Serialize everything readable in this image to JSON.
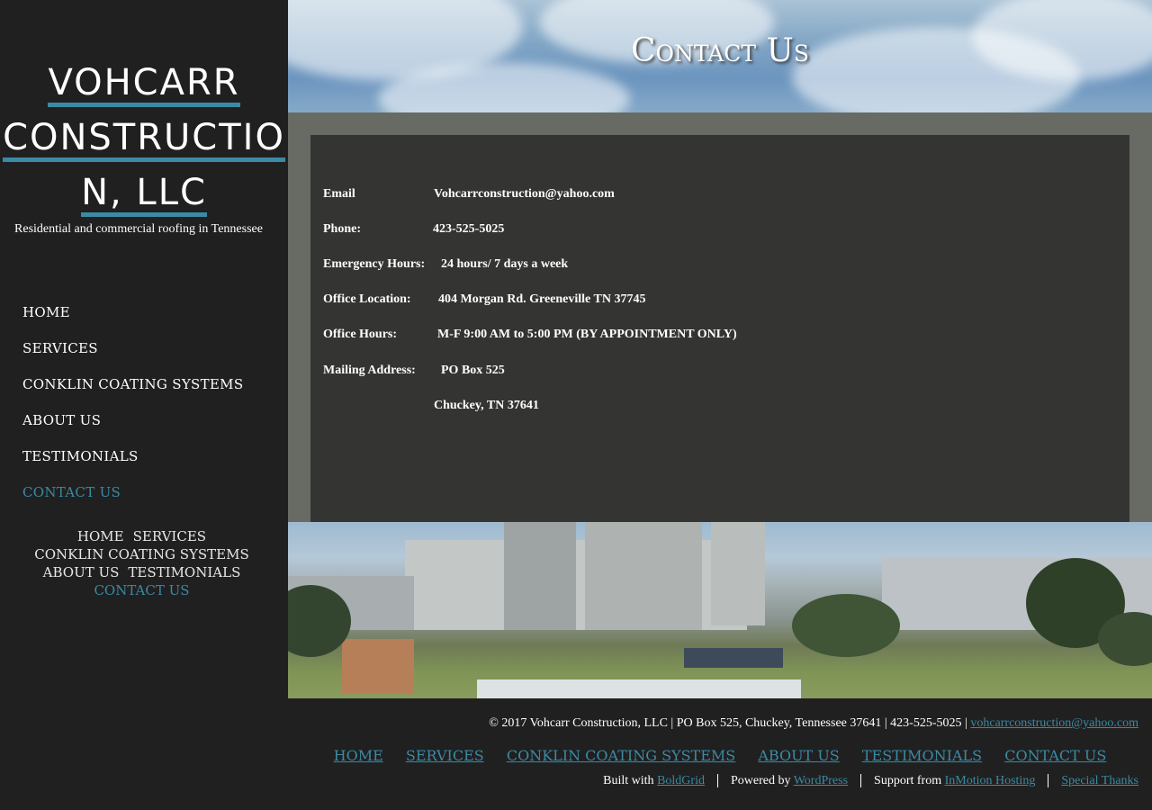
{
  "logo": {
    "line1": "VOHCARR",
    "line2": "CONSTRUCTIO",
    "line3": "N, LLC"
  },
  "tagline": "Residential and commercial roofing in Tennessee",
  "main_nav": [
    {
      "label": "HOME"
    },
    {
      "label": "SERVICES"
    },
    {
      "label": "CONKLIN COATING SYSTEMS"
    },
    {
      "label": "ABOUT US"
    },
    {
      "label": "TESTIMONIALS"
    },
    {
      "label": "CONTACT US"
    }
  ],
  "mini_nav": [
    "HOME",
    "SERVICES",
    "CONKLIN COATING SYSTEMS",
    "ABOUT US",
    "TESTIMONIALS",
    "CONTACT US"
  ],
  "hero_title": "Contact Us",
  "contact": {
    "email_label": "Email",
    "email_value": "Vohcarrconstruction@yahoo.com",
    "phone_label": "Phone:",
    "phone_value": "423-525-5025",
    "emergency_label": "Emergency Hours:",
    "emergency_value": "24 hours/ 7 days a week",
    "office_label": "Office Location:",
    "office_value": "404 Morgan Rd. Greeneville TN 37745",
    "hours_label": "Office Hours:",
    "hours_value": "M-F 9:00 AM to 5:00 PM (BY APPOINTMENT ONLY)",
    "mailing_label": "Mailing Address:",
    "mailing_value1": "PO Box 525",
    "mailing_value2": "Chuckey, TN 37641"
  },
  "footer": {
    "copyright": "© 2017 Vohcarr Construction, LLC | PO Box 525, Chuckey, Tennessee 37641 | 423-525-5025 |",
    "email": "vohcarrconstruction@yahoo.com",
    "nav": [
      "HOME",
      "SERVICES",
      "CONKLIN COATING SYSTEMS",
      "ABOUT US",
      "TESTIMONIALS",
      "CONTACT US"
    ],
    "built_text": "Built with",
    "built_link": "BoldGrid",
    "powered_text": "Powered by",
    "powered_link": "WordPress",
    "support_text": "Support from",
    "support_link": "InMotion Hosting",
    "thanks_link": "Special Thanks"
  },
  "colors": {
    "accent": "#3a8aa5",
    "sidebar_bg": "#202020",
    "card_bg": "#343532"
  }
}
